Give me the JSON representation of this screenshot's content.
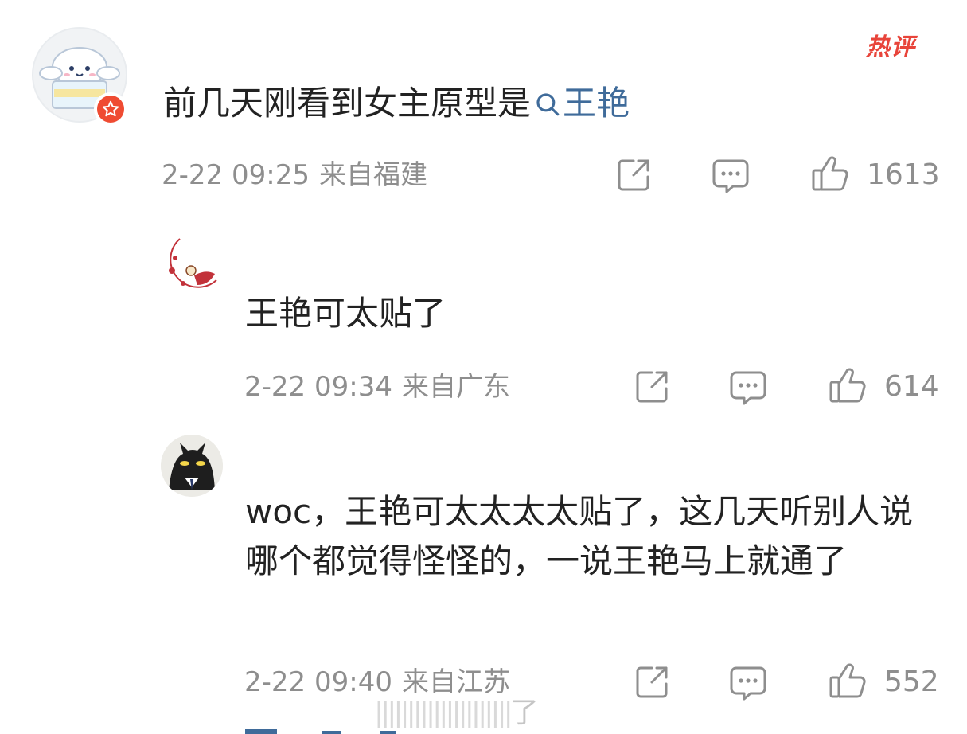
{
  "main_comment": {
    "text": "前几天刚看到女主原型是",
    "topic": "王艳",
    "time": "2-22 09:25",
    "location": "来自福建",
    "likes": "1613",
    "hot_label": "热评",
    "icons": [
      "share-icon",
      "comment-icon",
      "like-icon"
    ]
  },
  "replies": [
    {
      "text": "王艳可太贴了",
      "time": "2-22 09:34",
      "location": "来自广东",
      "likes": "614"
    },
    {
      "text": "woc，王艳可太太太太贴了，这几天听别人说哪个都觉得怪怪的，一说王艳马上就通了",
      "time": "2-22 09:40",
      "location": "来自江苏",
      "likes": "552"
    }
  ],
  "watermark": "了",
  "colors": {
    "text": "#222222",
    "meta": "#8e8e8e",
    "link": "#3f6b9a",
    "hot": "#e8443a",
    "badge": "#ef4b32"
  }
}
